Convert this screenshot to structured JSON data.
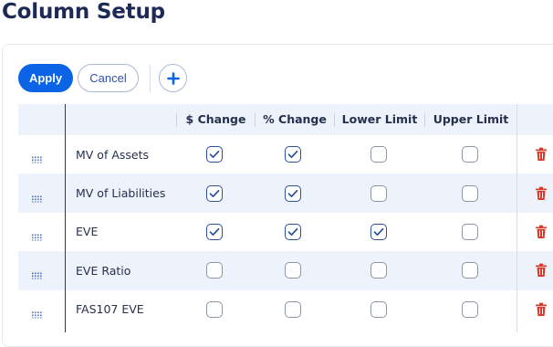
{
  "page": {
    "title": "Column Setup"
  },
  "toolbar": {
    "apply_label": "Apply",
    "cancel_label": "Cancel",
    "add_icon": "plus-icon"
  },
  "table": {
    "columns": [
      "$ Change",
      "% Change",
      "Lower Limit",
      "Upper Limit"
    ],
    "rows": [
      {
        "name": "MV of Assets",
        "checks": [
          true,
          true,
          false,
          false
        ]
      },
      {
        "name": "MV of Liabilities",
        "checks": [
          true,
          true,
          false,
          false
        ]
      },
      {
        "name": "EVE",
        "checks": [
          true,
          true,
          true,
          false
        ]
      },
      {
        "name": "EVE Ratio",
        "checks": [
          false,
          false,
          false,
          false
        ]
      },
      {
        "name": "FAS107 EVE",
        "checks": [
          false,
          false,
          false,
          false
        ]
      }
    ],
    "row_icons": {
      "drag": "drag-handle-icon",
      "delete": "trash-icon"
    }
  },
  "colors": {
    "primary": "#0b63e5",
    "header_bg": "#eef2fa",
    "delete": "#d93a2b",
    "title": "#1c2a55"
  }
}
